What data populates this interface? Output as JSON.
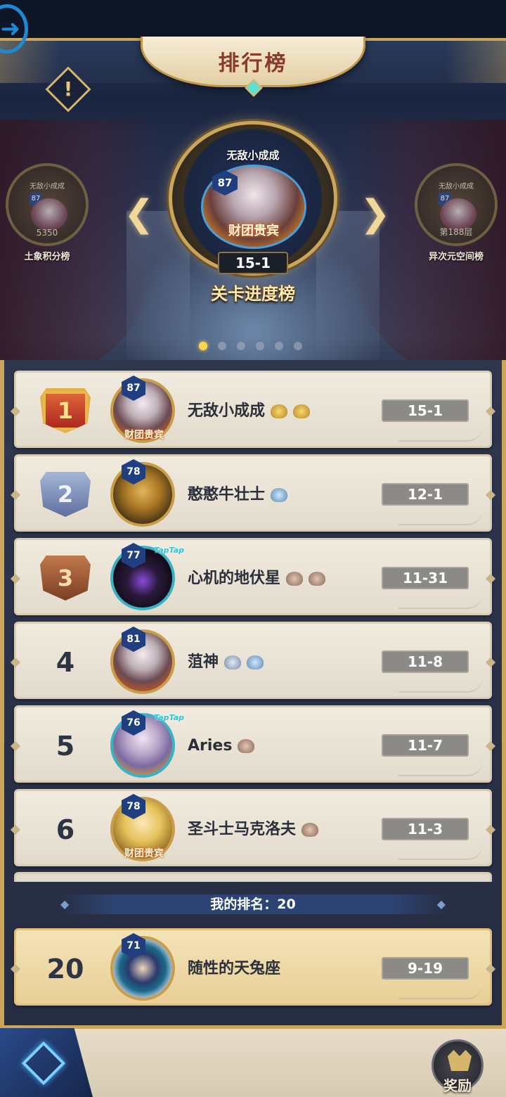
{
  "header": {
    "title": "排行榜",
    "back_icon": "arrow-right-circle-icon",
    "info_icon": "exclamation-icon",
    "info_label": "!"
  },
  "boards": {
    "left": {
      "player": "无敌小成成",
      "level": "87",
      "value": "5350",
      "label": "土象积分榜"
    },
    "main": {
      "player": "无敌小成成",
      "level": "87",
      "badge": "财团贵宾",
      "value": "15-1",
      "label": "关卡进度榜"
    },
    "right": {
      "player": "无敌小成成",
      "level": "87",
      "value": "第188层",
      "label": "异次元空间榜"
    },
    "prev_arrow": "❮",
    "next_arrow": "❯",
    "page_count": 6,
    "active_page": 1
  },
  "rankings": [
    {
      "rank": "1",
      "level": "87",
      "name": "无敌小成成",
      "score": "15-1",
      "vip": "财团贵宾",
      "emblems": [
        "gold",
        "gold"
      ]
    },
    {
      "rank": "2",
      "level": "78",
      "name": "憨憨牛壮士",
      "score": "12-1",
      "emblems": [
        "blue"
      ]
    },
    {
      "rank": "3",
      "level": "77",
      "name": "心机的地伏星",
      "score": "11-31",
      "tag": "TapTap",
      "emblems": [
        "bronze",
        "bronze"
      ]
    },
    {
      "rank": "4",
      "level": "81",
      "name": "菹神",
      "score": "11-8",
      "emblems": [
        "silver",
        "blue"
      ]
    },
    {
      "rank": "5",
      "level": "76",
      "name": "Aries",
      "score": "11-7",
      "tag": "TapTap",
      "emblems": [
        "bronze"
      ]
    },
    {
      "rank": "6",
      "level": "78",
      "name": "圣斗士马克洛夫",
      "score": "11-3",
      "vip": "财团贵宾",
      "emblems": [
        "bronze"
      ]
    }
  ],
  "my_rank": {
    "label": "我的排名：20",
    "rank": "20",
    "level": "71",
    "name": "随性的天兔座",
    "score": "9-19"
  },
  "footer": {
    "home_icon": "diamond-emblem-icon",
    "reward_icon": "crown-chest-icon",
    "reward_label": "奖励"
  },
  "colors": {
    "gold_trim": "#caa55a",
    "title_text": "#8a3a2a",
    "active_dot": "#ffd84a",
    "row_bg": "#f1ebdf",
    "my_row_bg": "#f4e2b8"
  }
}
